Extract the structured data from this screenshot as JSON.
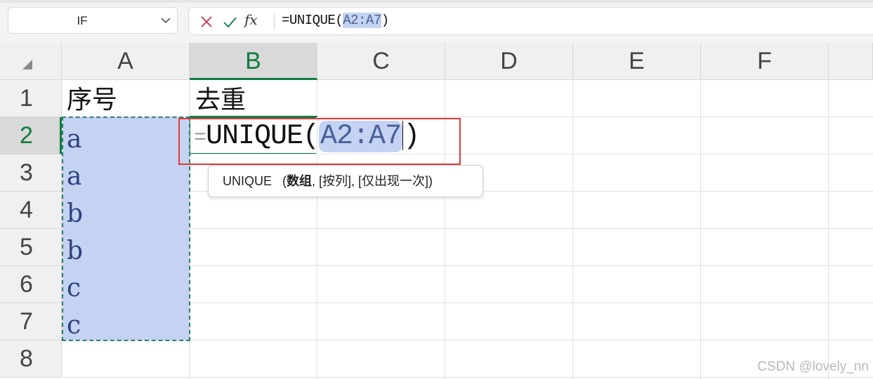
{
  "namebox": {
    "value": "IF"
  },
  "formula_bar": {
    "fx_label": "fx",
    "prefix": "=UNIQUE(",
    "ref": "A2:A7",
    "suffix": ")"
  },
  "columns": [
    "A",
    "B",
    "C",
    "D",
    "E",
    "F"
  ],
  "active_column": "B",
  "rows": [
    "1",
    "2",
    "3",
    "4",
    "5",
    "6",
    "7",
    "8"
  ],
  "active_row": "2",
  "cells": {
    "A1": "序号",
    "B1": "去重",
    "A2": "a",
    "A3": "a",
    "A4": "b",
    "A5": "b",
    "A6": "c",
    "A7": "c"
  },
  "editing_cell": {
    "address": "B2",
    "eq": "=",
    "func": "UNIQUE(",
    "ref": "A2:A7",
    "close": ")"
  },
  "tooltip": {
    "func": "UNIQUE",
    "open": "(",
    "arg1": "数组",
    "rest": ", [按列], [仅出现一次])"
  },
  "watermark": "CSDN @lovely_nn",
  "colors": {
    "accent_green": "#107c41",
    "selection_fill": "#c5d3f2",
    "highlight_box": "#e23a3a"
  }
}
